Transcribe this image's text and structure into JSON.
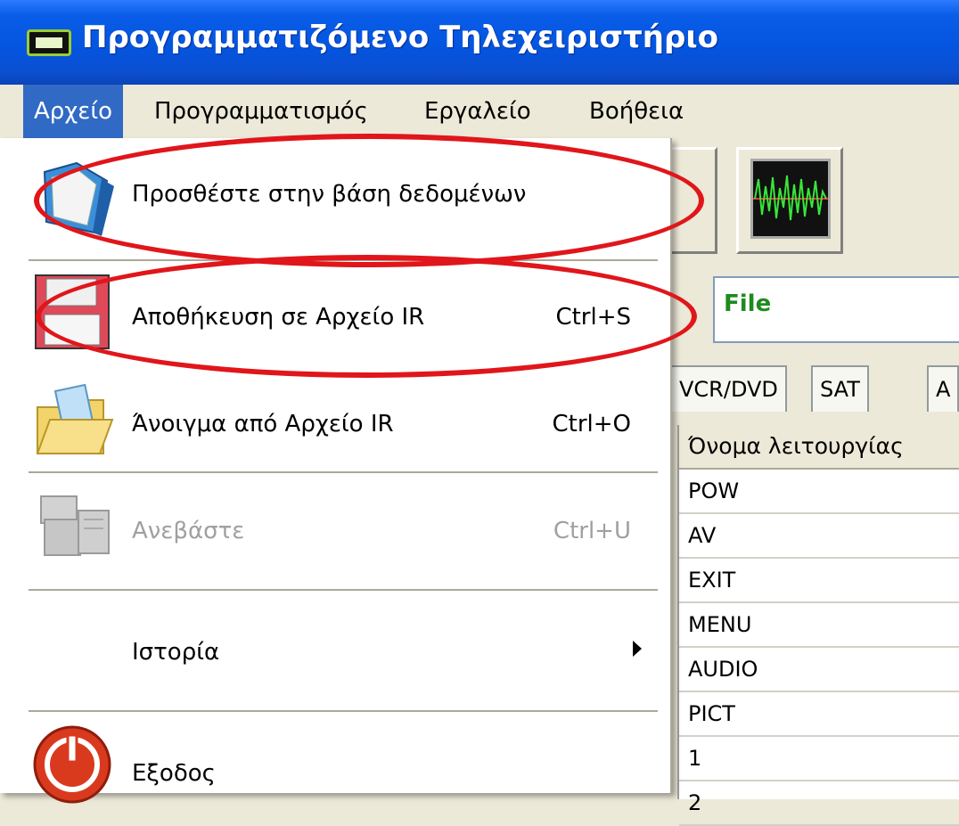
{
  "window": {
    "title": "Προγραμματιζόμενο Τηλεχειριστήριο"
  },
  "menubar": {
    "items": [
      {
        "label": "Αρχείο"
      },
      {
        "label": "Προγραμματισμός"
      },
      {
        "label": "Εργαλείο"
      },
      {
        "label": "Βοήθεια"
      }
    ]
  },
  "file_menu": {
    "items": [
      {
        "label": "Προσθέστε στην βάση δεδομένων",
        "shortcut": "",
        "icon": "folder-icon"
      },
      {
        "label": "Αποθήκευση σε Αρχείο IR",
        "shortcut": "Ctrl+S",
        "icon": "save-disk-icon"
      },
      {
        "label": "Άνοιγμα από Αρχείο IR",
        "shortcut": "Ctrl+O",
        "icon": "open-folder-icon"
      },
      {
        "label": "Ανεβάστε",
        "shortcut": "Ctrl+U",
        "icon": "upload-icon",
        "disabled": true
      },
      {
        "label": "Ιστορία",
        "submenu": true
      },
      {
        "label": "Εξοδος",
        "shortcut": "",
        "icon": "power-icon"
      }
    ]
  },
  "content": {
    "file_field_label": "File",
    "tabs": [
      "VCR/DVD",
      "SAT",
      "A"
    ],
    "table_header": "Όνομα λειτουργίας",
    "rows": [
      "POW",
      "AV",
      "EXIT",
      "MENU",
      "AUDIO",
      "PICT",
      "1",
      "2"
    ]
  },
  "colors": {
    "title_bar": "#0455e0",
    "menu_highlight": "#316ac5",
    "highlight_oval": "#e0161b",
    "file_label": "#1f8a1f"
  }
}
